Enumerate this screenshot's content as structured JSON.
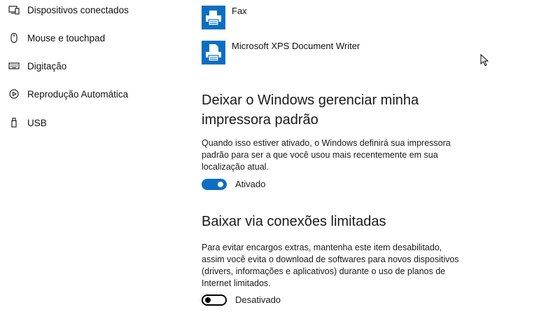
{
  "sidebar": {
    "items": [
      {
        "label": "Dispositivos conectados",
        "icon": "connected-devices-icon"
      },
      {
        "label": "Mouse e touchpad",
        "icon": "mouse-icon"
      },
      {
        "label": "Digitação",
        "icon": "keyboard-icon"
      },
      {
        "label": "Reprodução Automática",
        "icon": "autoplay-icon"
      },
      {
        "label": "USB",
        "icon": "usb-icon"
      }
    ]
  },
  "printers": [
    {
      "label": "Fax",
      "icon": "fax-printer-icon"
    },
    {
      "label": "Microsoft XPS Document Writer",
      "icon": "document-printer-icon"
    }
  ],
  "default_printer": {
    "title": "Deixar o Windows gerenciar minha impressora padrão",
    "description": "Quando isso estiver ativado, o Windows definirá sua impressora padrão para ser a que você usou mais recentemente em sua localização atual.",
    "toggle_state": "on",
    "toggle_label": "Ativado"
  },
  "metered": {
    "title": "Baixar via conexões limitadas",
    "description": "Para evitar encargos extras, mantenha este item desabilitado, assim você evita o download de softwares para novos dispositivos (drivers, informações e aplicativos) durante o uso de planos de Internet limitados.",
    "toggle_state": "off",
    "toggle_label": "Desativado"
  },
  "colors": {
    "accent": "#0a6fc2",
    "text": "#1a1a1a",
    "background": "#ffffff"
  }
}
